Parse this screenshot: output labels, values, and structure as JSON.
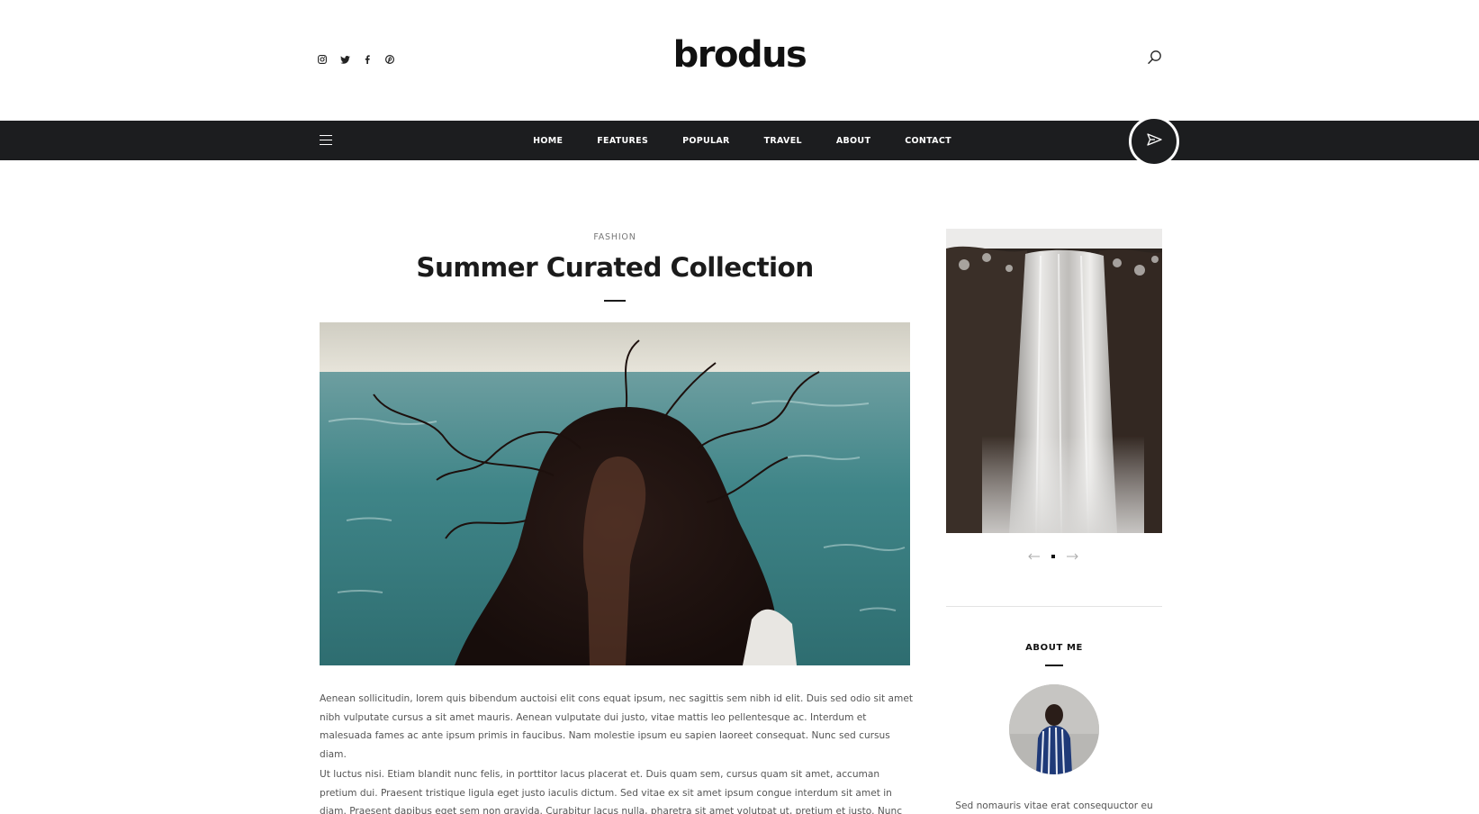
{
  "header": {
    "logo": "brodus",
    "social_icons": [
      "instagram-icon",
      "twitter-icon",
      "facebook-icon",
      "pinterest-icon"
    ],
    "search_icon": "search-icon"
  },
  "nav": {
    "items": [
      {
        "label": "HOME"
      },
      {
        "label": "FEATURES"
      },
      {
        "label": "POPULAR"
      },
      {
        "label": "TRAVEL"
      },
      {
        "label": "ABOUT"
      },
      {
        "label": "CONTACT"
      }
    ],
    "menu_icon": "hamburger-icon",
    "action_icon": "paper-plane-icon",
    "background": "#1c1d1f"
  },
  "post": {
    "category": "FASHION",
    "title": "Summer Curated Collection",
    "image": "woman-windblown-hair-by-sea",
    "paragraphs": [
      "Aenean sollicitudin, lorem quis bibendum auctoisi elit cons equat ipsum, nec sagittis sem nibh id elit. Duis sed odio sit amet nibh vulputate cursus a sit amet mauris. Aenean vulputate dui justo, vitae mattis leo pellentesque ac. Interdum et malesuada fames ac ante ipsum primis in faucibus. Nam molestie ipsum eu sapien laoreet consequat. Nunc sed cursus diam.",
      "Ut luctus nisi. Etiam blandit nunc felis, in porttitor lacus placerat et. Duis quam sem, cursus quam sit amet, accuman pretium dui. Praesent tristique ligula eget justo iaculis dictum. Sed vitae ex sit amet ipsum congue interdum sit amet in diam. Praesent dapibus eget sem non gravida. Curabitur lacus nulla, pharetra sit amet volutpat ut, pretium et justo. Nunc vel ipsum blandit"
    ]
  },
  "sidebar": {
    "slider": {
      "image": "waterfall",
      "prev_icon": "arrow-left-icon",
      "next_icon": "arrow-right-icon",
      "slide_count": 1,
      "active_slide": 1
    },
    "about": {
      "heading": "ABOUT ME",
      "avatar": "woman-striped-shirt-back-view",
      "text": "Sed nomauris vitae erat consequuctor eu"
    }
  }
}
